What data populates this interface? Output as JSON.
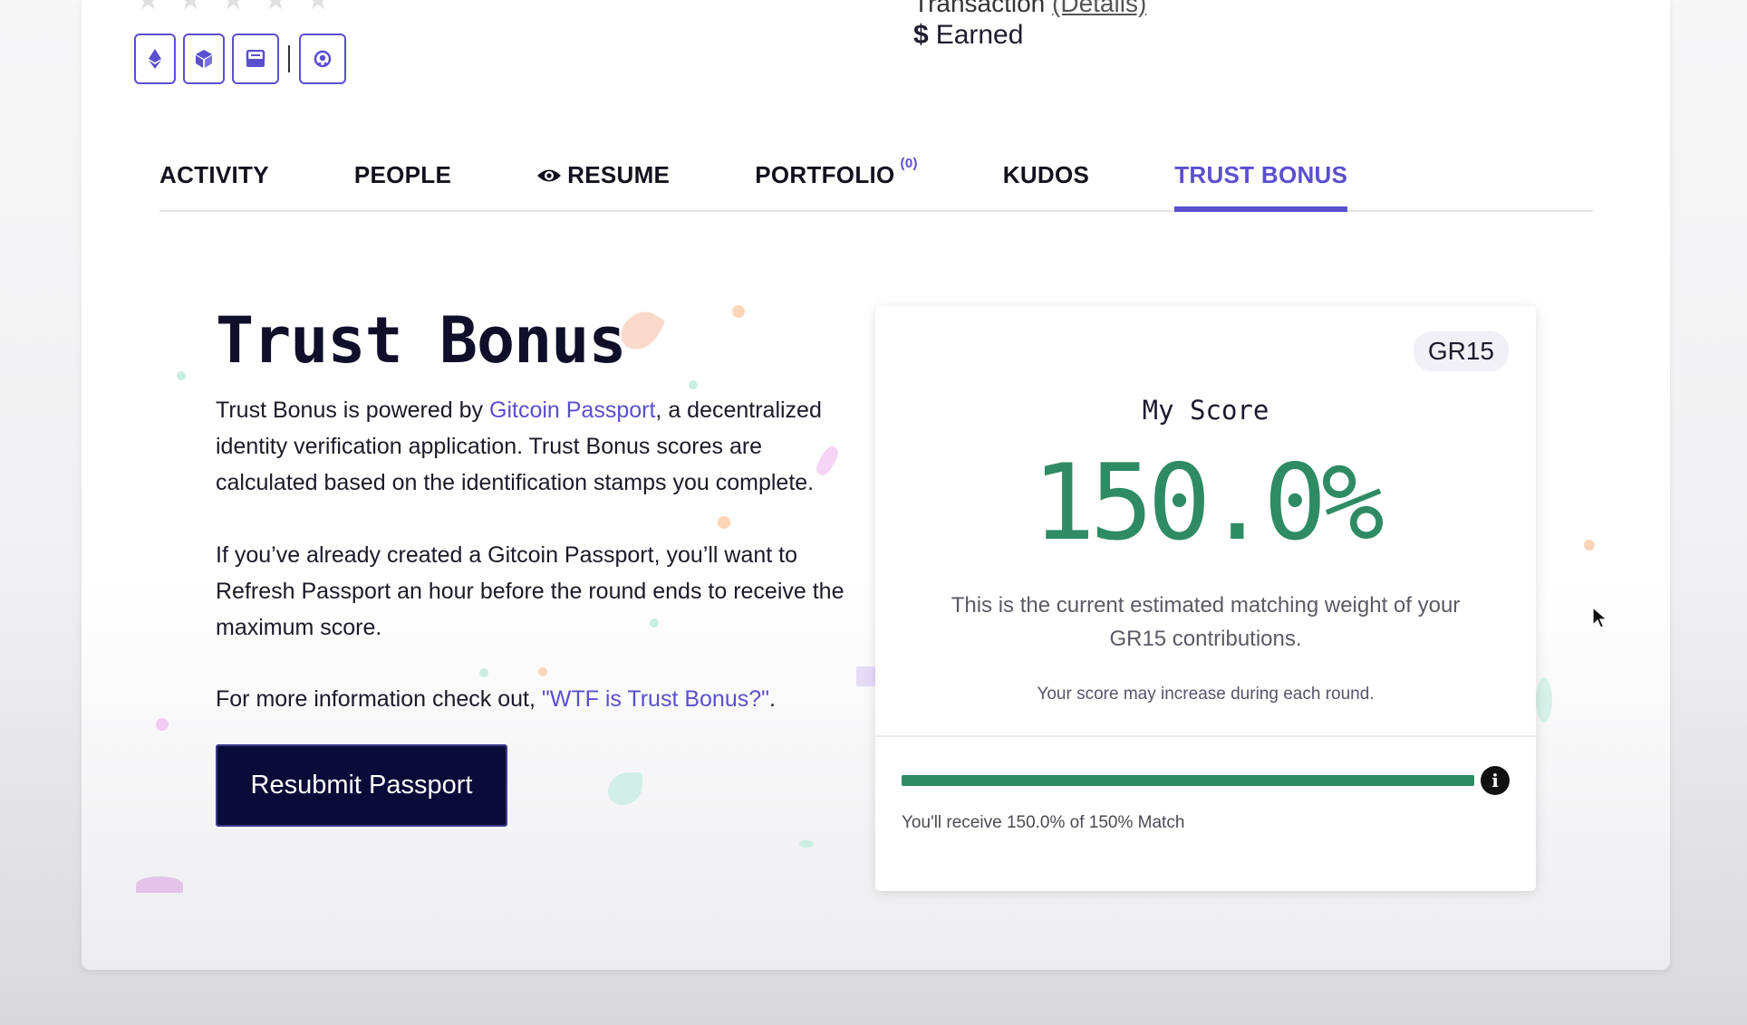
{
  "profile": {
    "rating_stars": 5,
    "transaction_label": "Transaction",
    "details_link": "(Details)",
    "earned_symbol": "$",
    "earned_label": "Earned",
    "icons": [
      "ethereum-icon",
      "cube-icon",
      "inbox-icon",
      "github-icon"
    ]
  },
  "tabs": [
    {
      "label": "ACTIVITY"
    },
    {
      "label": "PEOPLE"
    },
    {
      "label": "RESUME"
    },
    {
      "label": "PORTFOLIO",
      "count": "(0)"
    },
    {
      "label": "KUDOS"
    },
    {
      "label": "TRUST BONUS",
      "active": true
    }
  ],
  "intro": {
    "heading": "Trust Bonus",
    "p1_before": "Trust Bonus is powered by ",
    "p1_link": "Gitcoin Passport",
    "p1_after": ", a decentralized identity verification application. Trust Bonus scores are calculated based on the identification stamps you complete.",
    "p2": "If you’ve already created a Gitcoin Passport, you’ll want to Refresh Passport an hour before the round ends to receive the maximum score.",
    "p3_before": "For more information check out, ",
    "p3_link": "\"WTF is Trust Bonus?\"",
    "p3_after": ".",
    "button_label": "Resubmit Passport"
  },
  "score": {
    "round_badge": "GR15",
    "title": "My Score",
    "value": "150.0%",
    "description": "This is the current estimated matching weight of your GR15 contributions.",
    "note": "Your score may increase during each round.",
    "progress_fraction": 1.0,
    "match_text": "You'll receive 150.0% of 150% Match"
  },
  "colors": {
    "accent": "#5a4fcf",
    "score_green": "#2e8b63",
    "button_dark": "#0b0b3a"
  }
}
